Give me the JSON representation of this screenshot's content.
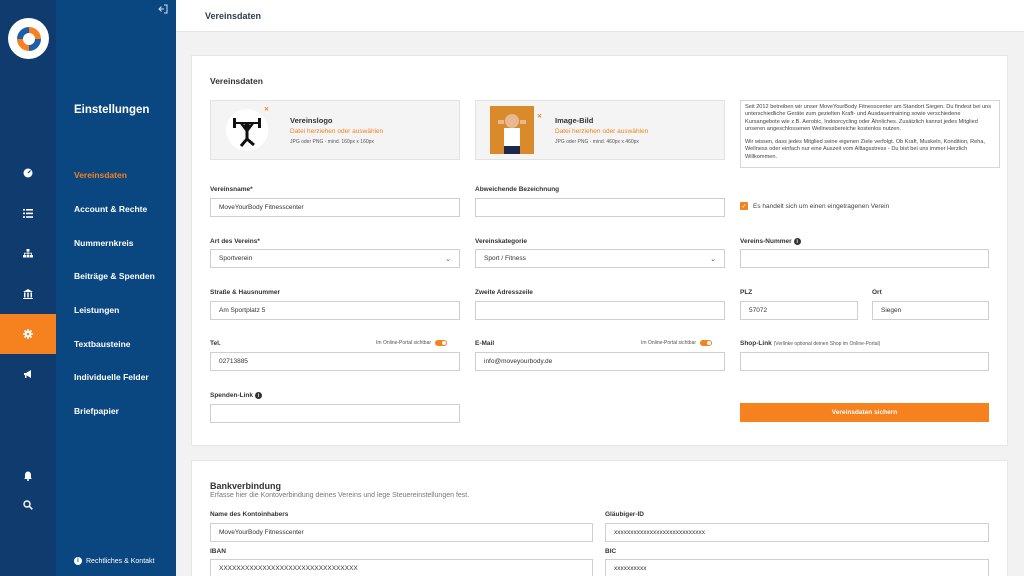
{
  "rail": {
    "icons": [
      "logo",
      "dashboard-icon",
      "list-icon",
      "sitemap-icon",
      "bank-icon",
      "gear-icon",
      "megaphone-icon",
      "bell-icon",
      "search-icon"
    ],
    "active_color": "#f5821f"
  },
  "panel": {
    "title": "Einstellungen",
    "items": [
      {
        "label": "Vereinsdaten",
        "active": true
      },
      {
        "label": "Account & Rechte"
      },
      {
        "label": "Nummernkreis"
      },
      {
        "label": "Beiträge & Spenden"
      },
      {
        "label": "Leistungen"
      },
      {
        "label": "Textbausteine"
      },
      {
        "label": "Individuelle Felder"
      },
      {
        "label": "Briefpapier"
      }
    ],
    "footer": "Rechtliches & Kontakt"
  },
  "header": {
    "title": "Vereinsdaten"
  },
  "vereinsdaten": {
    "title": "Vereinsdaten",
    "logo_upload": {
      "title": "Vereinslogo",
      "link": "Datei herziehen oder auswählen",
      "hint": "JPG oder PNG - mind. 160px x 160px"
    },
    "image_upload": {
      "title": "Image-Bild",
      "link": "Datei herziehen oder auswählen",
      "hint": "JPG oder PNG - mind. 460px x 460px"
    },
    "description_p1": "Seit 2012 betreiben wir unser MoveYourBody Fitnesscenter am Standort Siegen. Du findest bei uns unterschiedliche Geräte zum gezielten Kraft- und Ausdauertraining sowie verschiedene Kursangebote wie z.B. Aerobic, Indoorcycling oder Ähnliches. Zusätzlich kannst jedes Mitglied unseren angeschlossenen Wellnessbereiche kostenlos nutzen.",
    "description_p2": "Wir wissen, dass jedes Mitglied seine eigenen Ziele verfolgt. Ob Kraft, Muskeln, Kondition, Reha, Wellness oder einfach nur eine Auszeit vom Alltagsstress - Du bist bei uns immer Herzlich Willkommen.",
    "vereinsname_label": "Vereinsname*",
    "vereinsname_value": "MoveYourBody Fitnesscenter",
    "abw_label": "Abweichende Bezeichnung",
    "abw_value": "",
    "checkbox_label": "Es handelt sich um einen eingetragenen Verein",
    "art_label": "Art des Vereins*",
    "art_value": "Sportverein",
    "kategorie_label": "Vereinskategorie",
    "kategorie_value": "Sport / Fitness",
    "nummer_label": "Vereins-Nummer",
    "nummer_value": "",
    "strasse_label": "Straße & Hausnummer",
    "strasse_value": "Am Sportplatz 5",
    "adresse2_label": "Zweite Adresszeile",
    "adresse2_value": "",
    "plz_label": "PLZ",
    "plz_value": "57072",
    "ort_label": "Ort",
    "ort_value": "Siegen",
    "tel_label": "Tel.",
    "tel_toggle": "Im Online-Portal sichtbar",
    "tel_value": "02713885",
    "email_label": "E-Mail",
    "email_toggle": "Im Online-Portal sichtbar",
    "email_value": "info@moveyourbody.de",
    "shop_label": "Shop-Link",
    "shop_sub": "(Verlinke optional deinen Shop im Online-Portal)",
    "shop_value": "",
    "spenden_label": "Spenden-Link",
    "spenden_value": "",
    "save_label": "Vereinsdaten sichern"
  },
  "bank": {
    "title": "Bankverbindung",
    "subtitle": "Erfasse hier die Kontoverbindung deines Vereins und lege Steuereinstellungen fest.",
    "inhaber_label": "Name des Kontoinhabers",
    "inhaber_value": "MoveYourBody Fitnesscenter",
    "glaeubiger_label": "Gläubiger-ID",
    "glaeubiger_value": "xxxxxxxxxxxxxxxxxxxxxxxxxxxx",
    "iban_label": "IBAN",
    "iban_value": "XXXXXXXXXXXXXXXXXXXXXXXXXXXXXXXX",
    "bic_label": "BIC",
    "bic_value": "xxxxxxxxxx"
  }
}
